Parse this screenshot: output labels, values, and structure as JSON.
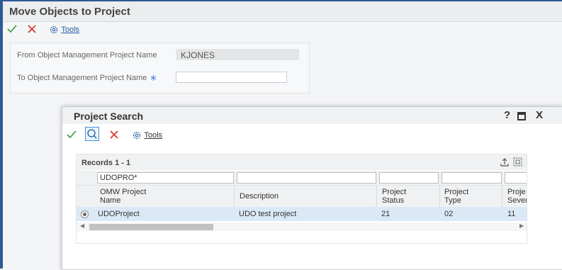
{
  "window": {
    "title": "Move Objects to Project"
  },
  "main_toolbar": {
    "tools_label": "Tools"
  },
  "form": {
    "from_label": "From Object Management Project Name",
    "from_value": "KJONES",
    "to_label": "To Object Management Project Name",
    "to_value": "",
    "required_mark": "∗"
  },
  "dialog": {
    "title": "Project Search",
    "help_label": "?",
    "close_label": "X",
    "toolbar": {
      "tools_label": "Tools"
    },
    "grid": {
      "records_label": "Records 1 - 1",
      "filter_values": [
        "UDOPRO*",
        "",
        "",
        "",
        ""
      ],
      "columns": [
        "OMW Project\nName",
        "Description",
        "Project\nStatus",
        "Project\nType",
        "Proje\nSever"
      ],
      "rows": [
        {
          "name": "UDOProject",
          "description": "UDO test project",
          "status": "21",
          "type": "02",
          "severity": "11"
        }
      ]
    }
  },
  "colors": {
    "accent": "#2f5a93",
    "ok_green": "#3a9a3a",
    "cancel_red": "#d9342b",
    "link_blue": "#1f5aa6",
    "selected_row": "#dbe9f6"
  }
}
